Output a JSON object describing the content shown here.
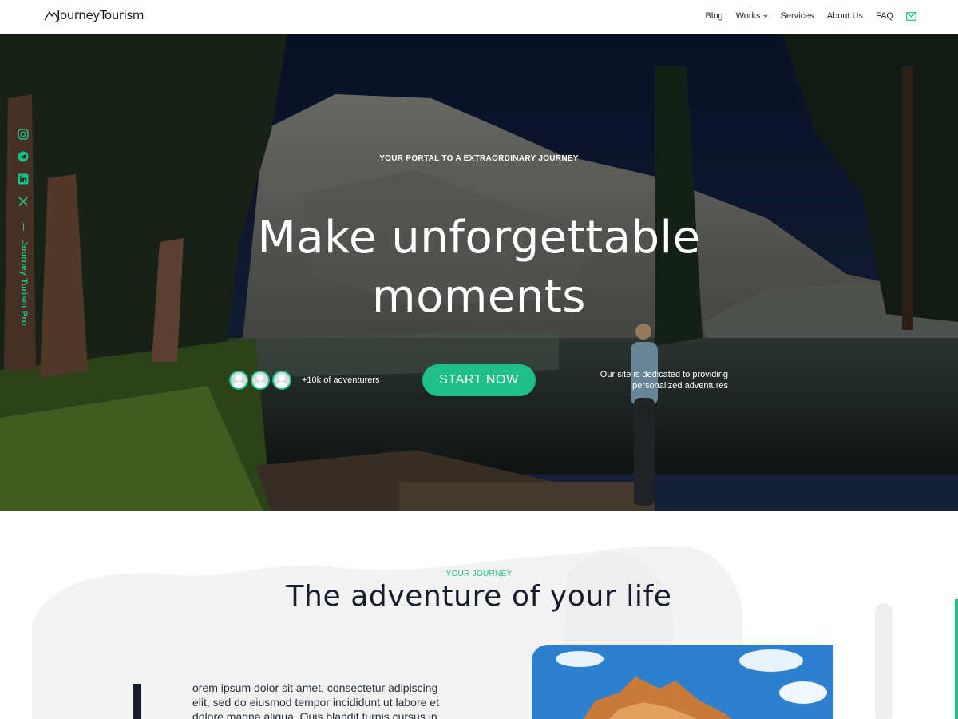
{
  "header": {
    "logo_text": "JourneyTourism",
    "nav": {
      "blog": "Blog",
      "works": "Works",
      "services": "Services",
      "about": "About Us",
      "faq": "FAQ"
    }
  },
  "hero": {
    "eyebrow": "YOUR PORTAL TO A EXTRAORDINARY JOURNEY",
    "title_line1": "Make unforgettable",
    "title_line2": "moments",
    "adventurers_label": "+10k of adventurers",
    "cta_label": "START NOW",
    "note_line1": "Our site is dedicated to providing",
    "note_line2": "personalized adventures",
    "side_brand": "Journey Turism Pro",
    "social_icons": [
      "instagram-icon",
      "telegram-icon",
      "linkedin-icon",
      "x-icon"
    ]
  },
  "section": {
    "eyebrow": "YOUR JOURNEY",
    "title": "The adventure of your life",
    "body_line1": "orem ipsum dolor sit amet, consectetur adipiscing",
    "body_line2": "elit, sed do eiusmod tempor incididunt ut labore et",
    "body_line3": "dolore magna aliqua. Quis blandit turpis cursus in"
  },
  "colors": {
    "accent": "#1fbf8a",
    "dark_text": "#161c2a"
  }
}
